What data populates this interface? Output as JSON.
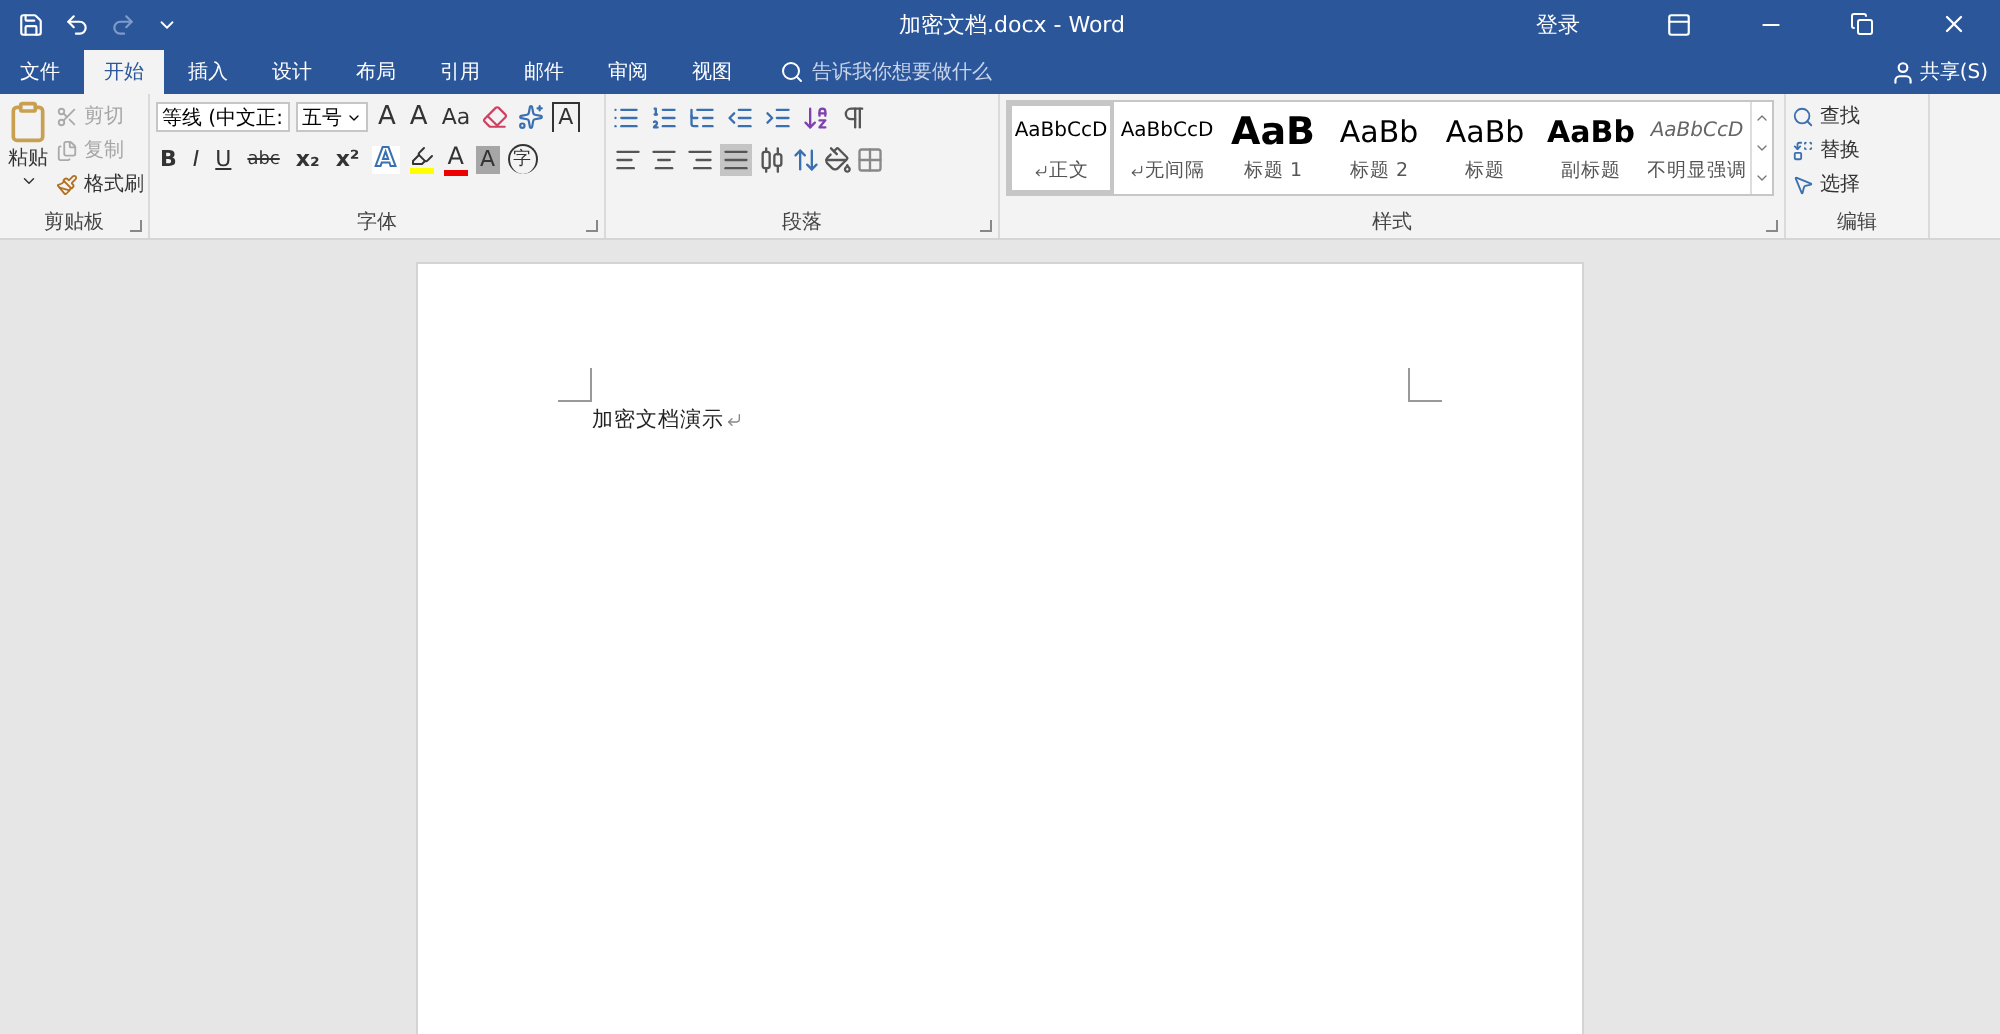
{
  "title_bar": {
    "title": "加密文档.docx  -  Word",
    "sign_in": "登录"
  },
  "tabs": [
    {
      "label": "文件",
      "selected": false,
      "kind": "file"
    },
    {
      "label": "开始",
      "selected": true,
      "kind": "tab"
    },
    {
      "label": "插入",
      "selected": false,
      "kind": "tab"
    },
    {
      "label": "设计",
      "selected": false,
      "kind": "tab"
    },
    {
      "label": "布局",
      "selected": false,
      "kind": "tab"
    },
    {
      "label": "引用",
      "selected": false,
      "kind": "tab"
    },
    {
      "label": "邮件",
      "selected": false,
      "kind": "tab"
    },
    {
      "label": "审阅",
      "selected": false,
      "kind": "tab"
    },
    {
      "label": "视图",
      "selected": false,
      "kind": "tab"
    }
  ],
  "tell_me": {
    "placeholder": "告诉我你想要做什么"
  },
  "share": "共享(S)",
  "clipboard": {
    "label": "剪贴板",
    "paste": "粘贴",
    "actions": [
      {
        "kind": "cut",
        "label": "剪切",
        "disabled": true
      },
      {
        "kind": "copy",
        "label": "复制",
        "disabled": true
      },
      {
        "kind": "painter",
        "label": "格式刷",
        "disabled": false
      }
    ]
  },
  "font": {
    "label": "字体",
    "font_name": "等线 (中文正:",
    "font_size": "五号",
    "row1": [
      {
        "kind": "grow",
        "label": "A"
      },
      {
        "kind": "shrink",
        "label": "A"
      },
      {
        "kind": "case",
        "label": "Aa"
      },
      {
        "kind": "clear"
      },
      {
        "kind": "phonetic"
      },
      {
        "kind": "border",
        "label": "A"
      }
    ],
    "row2": [
      {
        "kind": "bold",
        "label": "B"
      },
      {
        "kind": "italic",
        "label": "I"
      },
      {
        "kind": "underline",
        "label": "U"
      },
      {
        "kind": "strike",
        "label": "abc"
      },
      {
        "kind": "sub",
        "label": "x₂"
      },
      {
        "kind": "sup",
        "label": "x²"
      },
      {
        "kind": "effects",
        "label": "A"
      },
      {
        "kind": "highlight"
      },
      {
        "kind": "color",
        "label": "A"
      },
      {
        "kind": "shading",
        "label": "A"
      },
      {
        "kind": "enclose",
        "label": "字"
      }
    ]
  },
  "paragraph": {
    "label": "段落",
    "alignments": [
      {
        "kind": "left",
        "selected": false
      },
      {
        "kind": "center",
        "selected": false
      },
      {
        "kind": "right",
        "selected": false
      },
      {
        "kind": "justify",
        "selected": true
      },
      {
        "kind": "distributed",
        "selected": false
      }
    ]
  },
  "styles": {
    "label": "样式",
    "items": [
      {
        "preview": "AaBbCcD",
        "name": "正文",
        "kind": "normal",
        "mark": true,
        "selected": true
      },
      {
        "preview": "AaBbCcD",
        "name": "无间隔",
        "kind": "normal",
        "mark": true,
        "selected": false
      },
      {
        "preview": "AaB",
        "name": "标题 1",
        "kind": "heading1",
        "mark": false,
        "selected": false
      },
      {
        "preview": "AaBb",
        "name": "标题 2",
        "kind": "heading2",
        "mark": false,
        "selected": false
      },
      {
        "preview": "AaBb",
        "name": "标题",
        "kind": "title",
        "mark": false,
        "selected": false
      },
      {
        "preview": "AaBb",
        "name": "副标题",
        "kind": "subtitle",
        "mark": false,
        "selected": false
      },
      {
        "preview": "AaBbCcD",
        "name": "不明显强调",
        "kind": "emphasis",
        "mark": false,
        "selected": false
      }
    ]
  },
  "editing": {
    "label": "编辑",
    "actions": [
      {
        "kind": "find",
        "label": "查找"
      },
      {
        "kind": "replace",
        "label": "替换"
      },
      {
        "kind": "select",
        "label": "选择"
      }
    ]
  },
  "document": {
    "text": "加密文档演示"
  }
}
